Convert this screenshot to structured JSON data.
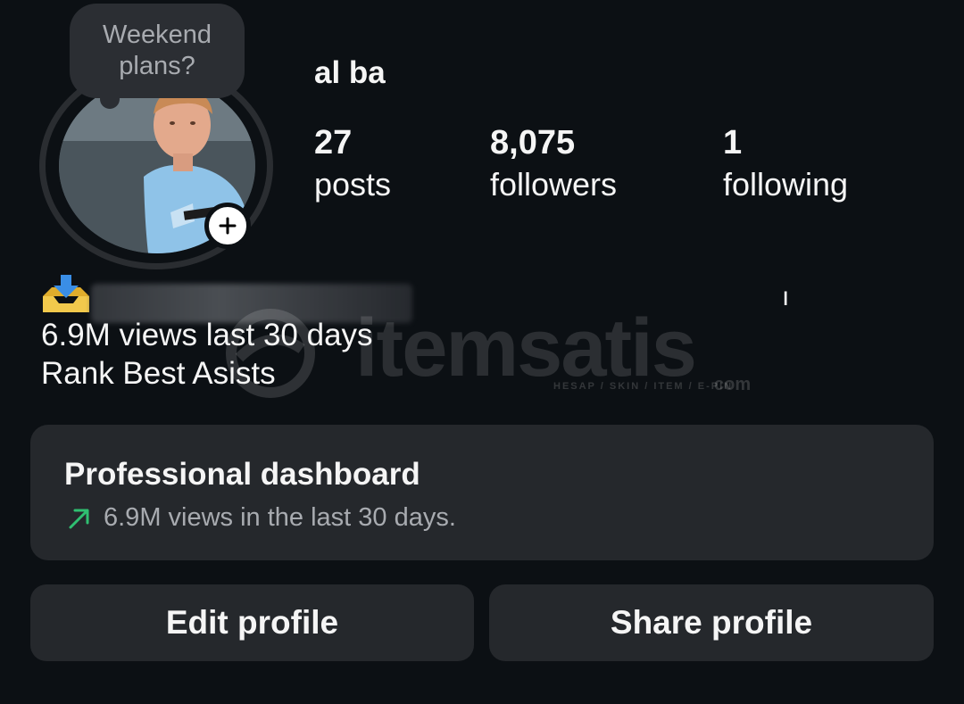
{
  "note": {
    "text": "Weekend plans?"
  },
  "profile": {
    "username": "al ba",
    "stats": [
      {
        "value": "27",
        "label": "posts"
      },
      {
        "value": "8,075",
        "label": "followers"
      },
      {
        "value": "1",
        "label": "following"
      }
    ]
  },
  "bio": {
    "side_fragment": "ı",
    "line1": "6.9M views last 30 days",
    "line2": "Rank Best Asists"
  },
  "watermark": {
    "brand": "itemsatis",
    "tagline": "HESAP / SKIN / ITEM / E-PIN",
    "domain": "com"
  },
  "dashboard": {
    "title": "Professional dashboard",
    "subtitle": "6.9M views in the last 30 days.",
    "trend_color": "#2fbf71"
  },
  "buttons": {
    "edit": "Edit profile",
    "share": "Share profile"
  },
  "icons": {
    "add_story": "plus-icon",
    "trend": "trend-up-arrow-icon",
    "bio_emoji": "inbox-tray-emoji"
  }
}
